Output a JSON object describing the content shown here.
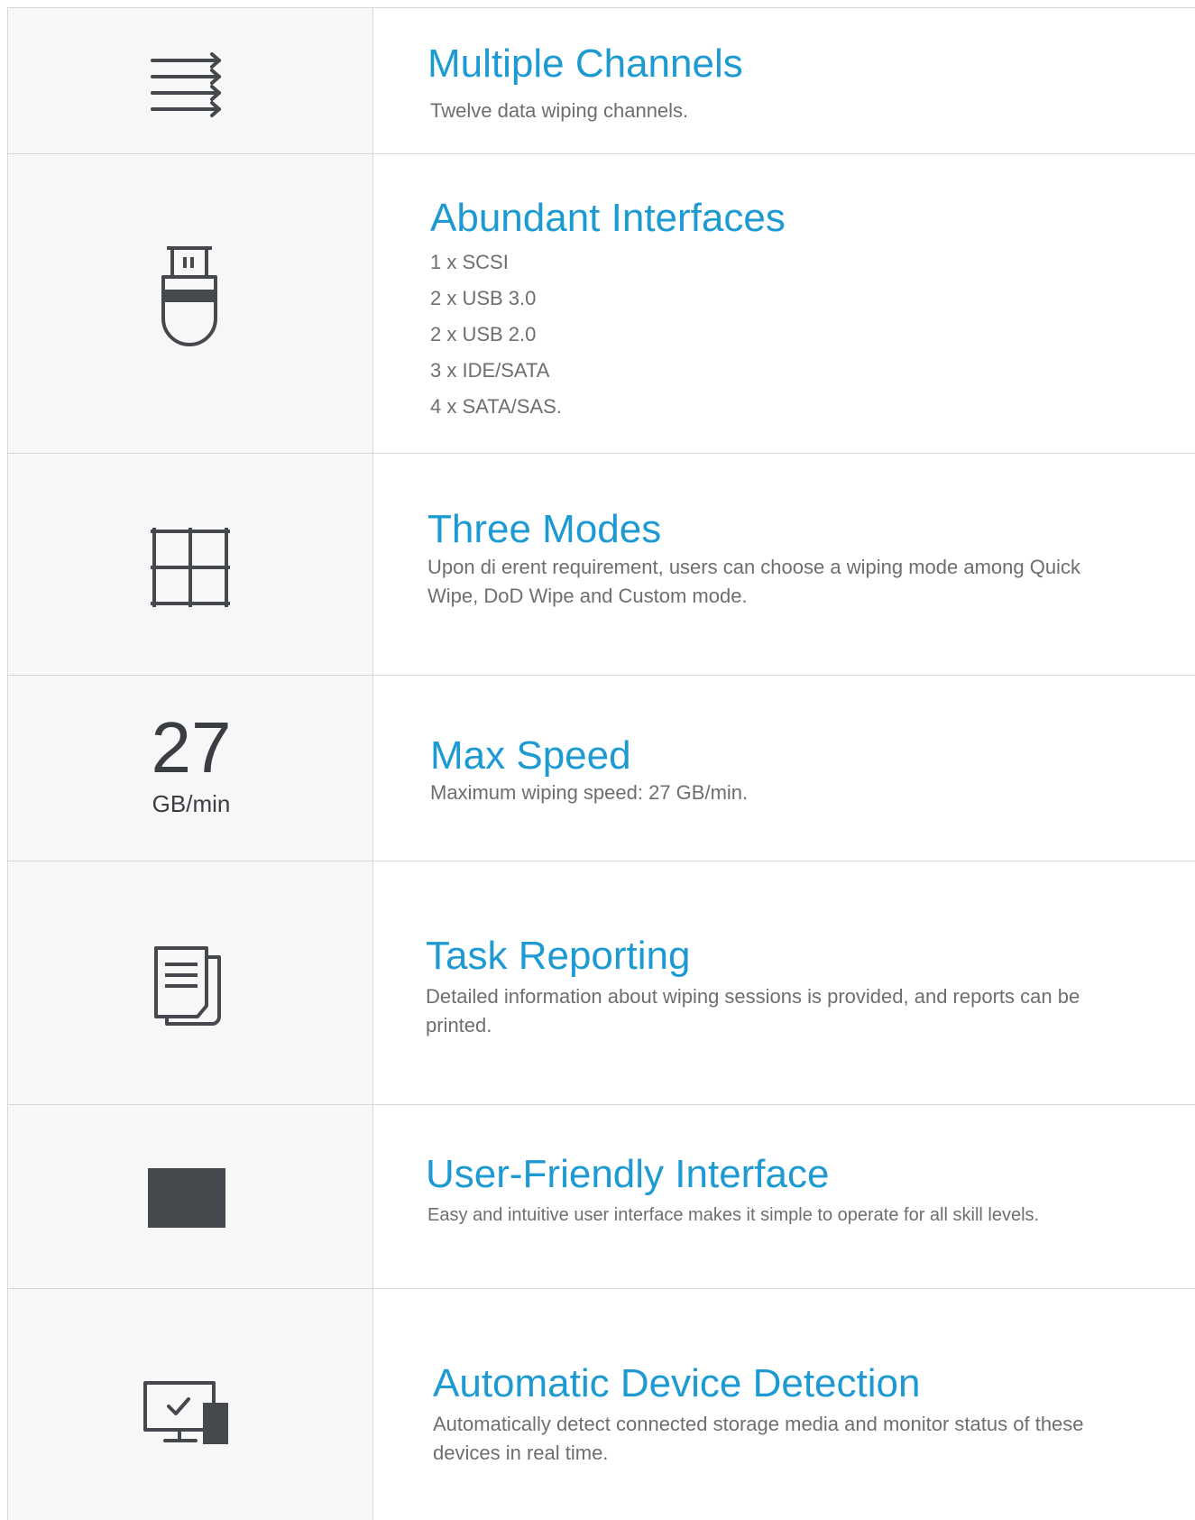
{
  "colors": {
    "title": "#1e9ad2",
    "body_text": "#6d6e70",
    "icon": "#45484d",
    "icon_panel_bg": "#f7f7f8",
    "divider": "#d6d9dc"
  },
  "features": [
    {
      "icon": "arrows-icon",
      "title": "Multiple Channels",
      "description": "Twelve data wiping channels."
    },
    {
      "icon": "usb-icon",
      "title": "Abundant Interfaces",
      "lines": [
        "1 x SCSI",
        "2 x USB 3.0",
        "2 x USB 2.0",
        "3 x IDE/SATA",
        "4 x SATA/SAS."
      ]
    },
    {
      "icon": "grid-icon",
      "title": "Three Modes",
      "description": "Upon di erent requirement, users can choose a wiping mode among Quick Wipe, DoD Wipe and Custom mode."
    },
    {
      "icon": "speed-readout",
      "speed_value": "27",
      "speed_unit": "GB/min",
      "title": "Max Speed",
      "description": "Maximum wiping speed: 27 GB/min."
    },
    {
      "icon": "documents-icon",
      "title": "Task Reporting",
      "description": "Detailed information about wiping sessions is provided, and reports can be printed."
    },
    {
      "icon": "screen-icon",
      "title": "User-Friendly Interface",
      "description": "Easy and intuitive user interface makes it simple to operate for all skill levels."
    },
    {
      "icon": "monitor-check-icon",
      "title": "Automatic Device Detection",
      "description": "Automatically detect connected storage media and monitor status of these devices in real time."
    }
  ]
}
